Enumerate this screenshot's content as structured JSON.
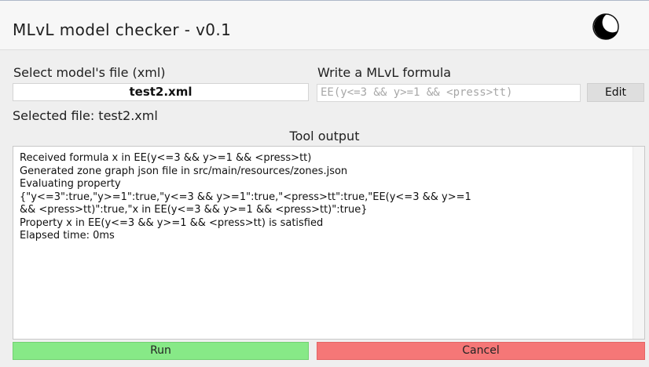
{
  "app": {
    "title": "MLvL model checker - v0.1",
    "theme_icon": "moon-icon"
  },
  "inputs": {
    "file_label": "Select model's file (xml)",
    "file_value": "test2.xml",
    "formula_label": "Write a MLvL formula",
    "formula_value": "EE(y<=3 && y>=1 && <press>tt)",
    "edit_label": "Edit"
  },
  "status": {
    "selected_file": "Selected file: test2.xml"
  },
  "output": {
    "title": "Tool output",
    "lines": [
      "Received formula x in EE(y<=3 && y>=1 && <press>tt)",
      "Generated zone graph json file in src/main/resources/zones.json",
      "Evaluating property",
      "{\"y<=3\":true,\"y>=1\":true,\"y<=3 && y>=1\":true,\"<press>tt\":true,\"EE(y<=3 && y>=1",
      "&& <press>tt)\":true,\"x in EE(y<=3 && y>=1 && <press>tt)\":true}",
      "Property x in EE(y<=3 && y>=1 && <press>tt) is satisfied",
      "Elapsed time: 0ms"
    ]
  },
  "actions": {
    "run_label": "Run",
    "cancel_label": "Cancel"
  },
  "colors": {
    "run": "#87e987",
    "cancel": "#f57777"
  }
}
